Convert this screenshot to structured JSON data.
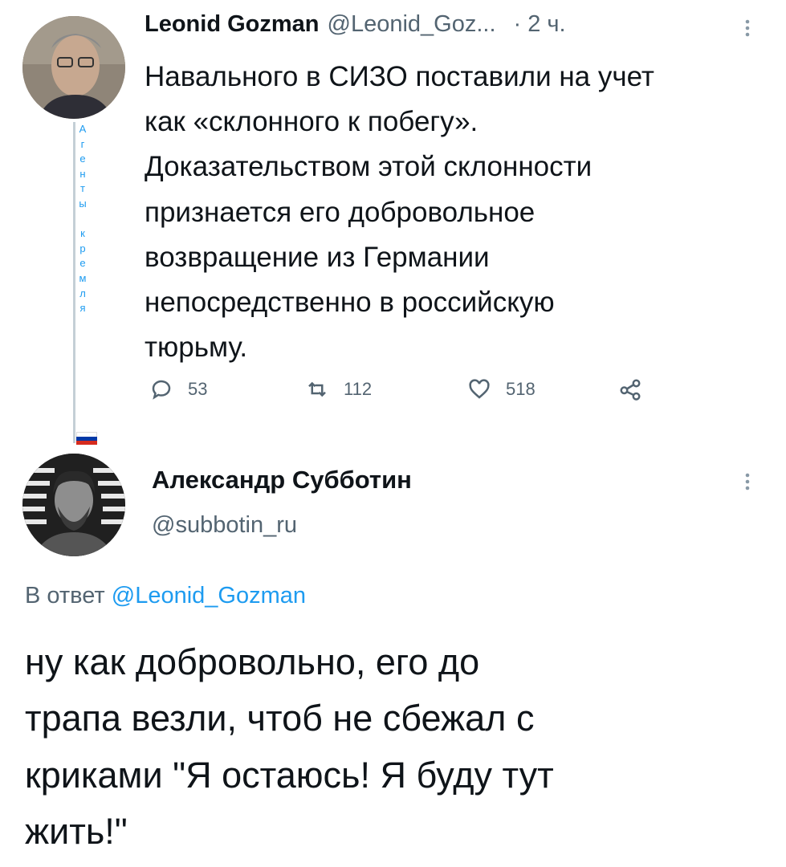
{
  "tweet1": {
    "display_name": "Leonid Gozman",
    "handle": "@Leonid_Goz...",
    "time": "· 2 ч.",
    "text_lines": [
      "Навального в СИЗО поставили на учет",
      "как «склонного к побегу».",
      "Доказательством этой склонности",
      "признается его добровольное",
      "возвращение из Германии",
      "непосредственно в российскую",
      "тюрьму."
    ],
    "label_letters": [
      "А",
      "г",
      "е",
      "н",
      "т",
      "ы",
      "",
      "к",
      "р",
      "е",
      "м",
      "л",
      "я"
    ],
    "reply_count": "53",
    "retweet_count": "112",
    "like_count": "518"
  },
  "tweet2": {
    "display_name": "Александр Субботин",
    "handle": "@subbotin_ru",
    "reply_prefix": "В ответ",
    "reply_to": "@Leonid_Gozman",
    "text_lines": [
      "ну как добровольно, его до",
      "трапа везли, чтоб не сбежал с",
      "криками \"Я остаюсь! Я буду тут",
      "жить!\""
    ]
  },
  "colors": {
    "link": "#1d9bf0",
    "muted": "#536471",
    "text": "#0f1419",
    "thread_line": "#c4cfd6"
  },
  "icons": [
    "reply-icon",
    "retweet-icon",
    "like-icon",
    "share-icon",
    "more-icon",
    "russian-flag-icon"
  ]
}
